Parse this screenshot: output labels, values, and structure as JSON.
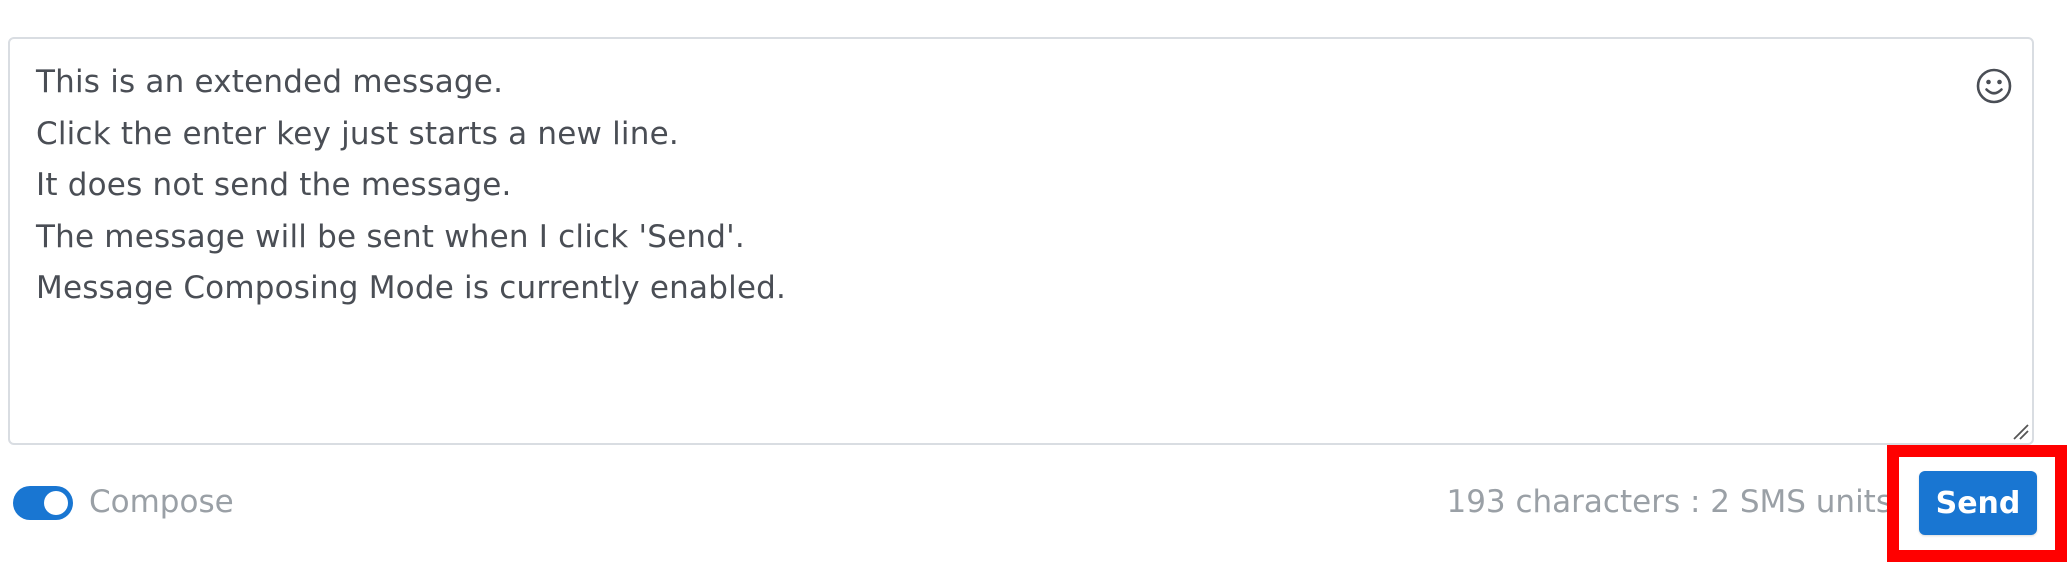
{
  "composer": {
    "message_lines": [
      "This is an extended message.",
      "Click the enter key just starts a new line.",
      "It does not send the message.",
      "The message will be sent when I click 'Send'.",
      "Message Composing Mode is currently enabled."
    ],
    "emoji_icon": "smiley-face-icon",
    "resize_icon": "resize-handle-icon"
  },
  "footer": {
    "compose_toggle": {
      "label": "Compose",
      "enabled": true
    },
    "char_count_text": "193 characters : 2 SMS units",
    "send_label": "Send"
  },
  "colors": {
    "accent": "#1976d2",
    "highlight": "#ff0000",
    "text": "#4a4e55",
    "muted_text": "#9aa0a6",
    "border": "#d9dde2"
  }
}
